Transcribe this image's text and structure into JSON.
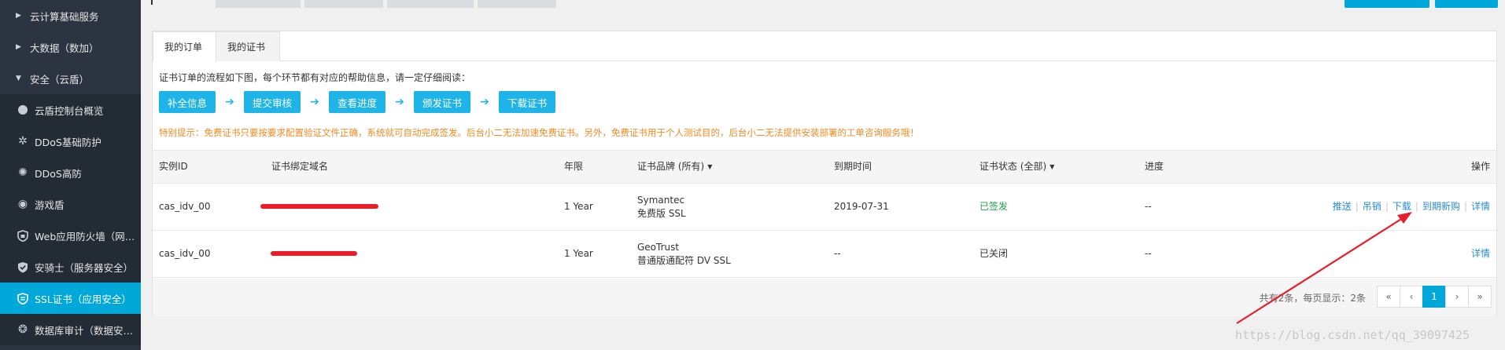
{
  "sidebar": {
    "groups": [
      {
        "label": "云计算基础服务"
      },
      {
        "label": "大数据（数加）"
      },
      {
        "label": "安全（云盾）"
      }
    ],
    "items": [
      {
        "label": "云盾控制台概览",
        "icon": "dot-icon"
      },
      {
        "label": "DDoS基础防护",
        "icon": "snowflake-icon"
      },
      {
        "label": "DDoS高防",
        "icon": "gear-icon"
      },
      {
        "label": "游戏盾",
        "icon": "game-shield-icon"
      },
      {
        "label": "Web应用防火墙（网…",
        "icon": "shield-icon"
      },
      {
        "label": "安骑士（服务器安全）",
        "icon": "shield-check-icon"
      },
      {
        "label": "SSL证书（应用安全）",
        "icon": "certificate-shield-icon"
      },
      {
        "label": "数据库审计（数据安…",
        "icon": "database-audit-icon"
      }
    ]
  },
  "tabs": [
    {
      "label": "我的订单"
    },
    {
      "label": "我的证书"
    }
  ],
  "intro": "证书订单的流程如下图，每个环节都有对应的帮助信息，请一定仔细阅读：",
  "steps": [
    "补全信息",
    "提交审核",
    "查看进度",
    "颁发证书",
    "下载证书"
  ],
  "tip": "特别提示：免费证书只要按要求配置验证文件正确，系统就可自动完成签发。后台小二无法加速免费证书。另外，免费证书用于个人测试目的，后台小二无法提供安装部署的工单咨询服务哦！",
  "table": {
    "headers": {
      "id": "实例ID",
      "domain": "证书绑定域名",
      "term": "年限",
      "brand": "证书品牌 (所有)",
      "expire": "到期时间",
      "status": "证书状态 (全部)",
      "progress": "进度",
      "ops": "操作"
    },
    "rows": [
      {
        "id": "cas_idv_00",
        "term": "1 Year",
        "brand_line1": "Symantec",
        "brand_line2": "免费版 SSL",
        "expire": "2019-07-31",
        "status": "已签发",
        "progress": "--",
        "ops": [
          "推送",
          "吊销",
          "下载",
          "到期新购",
          "详情"
        ]
      },
      {
        "id": "cas_idv_00",
        "term": "1 Year",
        "brand_line1": "GeoTrust",
        "brand_line2": "普通版通配符 DV SSL",
        "expire": "--",
        "status": "已关闭",
        "progress": "--",
        "ops": [
          "详情"
        ]
      }
    ]
  },
  "pagination": {
    "summary": "共有2条，每页显示：2条",
    "first": "«",
    "prev": "‹",
    "current": "1",
    "next": "›",
    "last": "»"
  },
  "watermark": "https://blog.csdn.net/qq_39097425",
  "colors": {
    "accent": "#00a8d9",
    "success": "#22a047",
    "warning": "#f08a24",
    "link": "#2a8bd4",
    "annotation": "#e81e2a"
  }
}
